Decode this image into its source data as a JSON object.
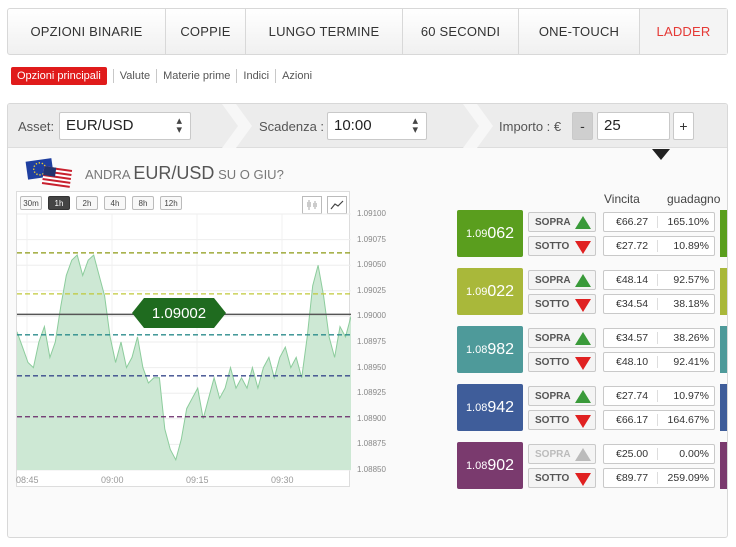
{
  "tabs": [
    "OPZIONI BINARIE",
    "COPPIE",
    "LUNGO TERMINE",
    "60 SECONDI",
    "ONE-TOUCH",
    "LADDER"
  ],
  "subnav": {
    "active": "Opzioni principali",
    "links": [
      "Valute",
      "Materie prime",
      "Indici",
      "Azioni"
    ]
  },
  "controls": {
    "asset_label": "Asset:",
    "asset_value": "EUR/USD",
    "expiry_label": "Scadenza :",
    "expiry_value": "10:00",
    "amount_label": "Importo : €",
    "minus": "-",
    "amount_value": "25",
    "plus": "+"
  },
  "question": {
    "prefix": "ANDRA",
    "pair": "EUR/USD",
    "suffix": "SU O GIU?"
  },
  "timeframes": [
    "30m",
    "1h",
    "2h",
    "4h",
    "8h",
    "12h"
  ],
  "active_timeframe": "1h",
  "chart_data": {
    "type": "area",
    "y_ticks": [
      "1.09100",
      "1.09075",
      "1.09050",
      "1.09025",
      "1.09000",
      "1.08975",
      "1.08950",
      "1.08925",
      "1.08900",
      "1.08875",
      "1.08850"
    ],
    "x_ticks": [
      "08:45",
      "09:00",
      "09:15",
      "09:30"
    ],
    "ylim": [
      1.0885,
      1.091
    ],
    "current_price": "1.09002",
    "levels": [
      1.09062,
      1.09022,
      1.08982,
      1.08942,
      1.08902
    ],
    "series": [
      {
        "values": [
          1.08985,
          1.0897,
          1.08955,
          1.0895,
          1.08975,
          1.0899,
          1.0896,
          1.08975,
          1.0901,
          1.0904,
          1.09055,
          1.0906,
          1.0904,
          1.09055,
          1.0906,
          1.0904,
          1.0902,
          1.0898,
          1.08955,
          1.08975,
          1.0895,
          1.0896,
          1.0898,
          1.0895,
          1.08935,
          1.0894,
          1.0894,
          1.0889,
          1.0887,
          1.0886,
          1.0888,
          1.0891,
          1.0892,
          1.0893,
          1.089,
          1.0892,
          1.0894,
          1.0892,
          1.0893,
          1.0895,
          1.0893,
          1.0894,
          1.0893,
          1.0895,
          1.0893,
          1.0895,
          1.0896,
          1.0894,
          1.0896,
          1.0897,
          1.0895,
          1.0896,
          1.0894,
          1.0898,
          1.0903,
          1.0905,
          1.0902,
          1.0898,
          1.0896,
          1.0899,
          1.0898,
          1.09
        ]
      }
    ],
    "colors": {
      "fill": "#cde8d4",
      "line": "#8ccc9c",
      "level_green": "#8c9a14",
      "level_teal": "#2c8c8c",
      "level_navy": "#3a4a8c",
      "level_purple": "#6a2a6a",
      "price": "#1f6b1f"
    }
  },
  "columns": {
    "vincita": "Vincita",
    "guadagno": "guadagno"
  },
  "ladder": [
    {
      "prefix": "1.09",
      "big": "062",
      "color": "#5a9e1e",
      "sopra_label": "SOPRA",
      "sotto_label": "SOTTO",
      "sopra_amount": "€66.27",
      "sopra_pct": "165.10%",
      "sotto_amount": "€27.72",
      "sotto_pct": "10.89%",
      "sopra_disabled": false
    },
    {
      "prefix": "1.09",
      "big": "022",
      "color": "#a9b83a",
      "sopra_label": "SOPRA",
      "sotto_label": "SOTTO",
      "sopra_amount": "€48.14",
      "sopra_pct": "92.57%",
      "sotto_amount": "€34.54",
      "sotto_pct": "38.18%",
      "sopra_disabled": false
    },
    {
      "prefix": "1.08",
      "big": "982",
      "color": "#4e9a9a",
      "sopra_label": "SOPRA",
      "sotto_label": "SOTTO",
      "sopra_amount": "€34.57",
      "sopra_pct": "38.26%",
      "sotto_amount": "€48.10",
      "sotto_pct": "92.41%",
      "sopra_disabled": false
    },
    {
      "prefix": "1.08",
      "big": "942",
      "color": "#3f5d9a",
      "sopra_label": "SOPRA",
      "sotto_label": "SOTTO",
      "sopra_amount": "€27.74",
      "sopra_pct": "10.97%",
      "sotto_amount": "€66.17",
      "sotto_pct": "164.67%",
      "sopra_disabled": false
    },
    {
      "prefix": "1.08",
      "big": "902",
      "color": "#7a3a6e",
      "sopra_label": "SOPRA",
      "sotto_label": "SOTTO",
      "sopra_amount": "€25.00",
      "sopra_pct": "0.00%",
      "sotto_amount": "€89.77",
      "sotto_pct": "259.09%",
      "sopra_disabled": true
    }
  ]
}
